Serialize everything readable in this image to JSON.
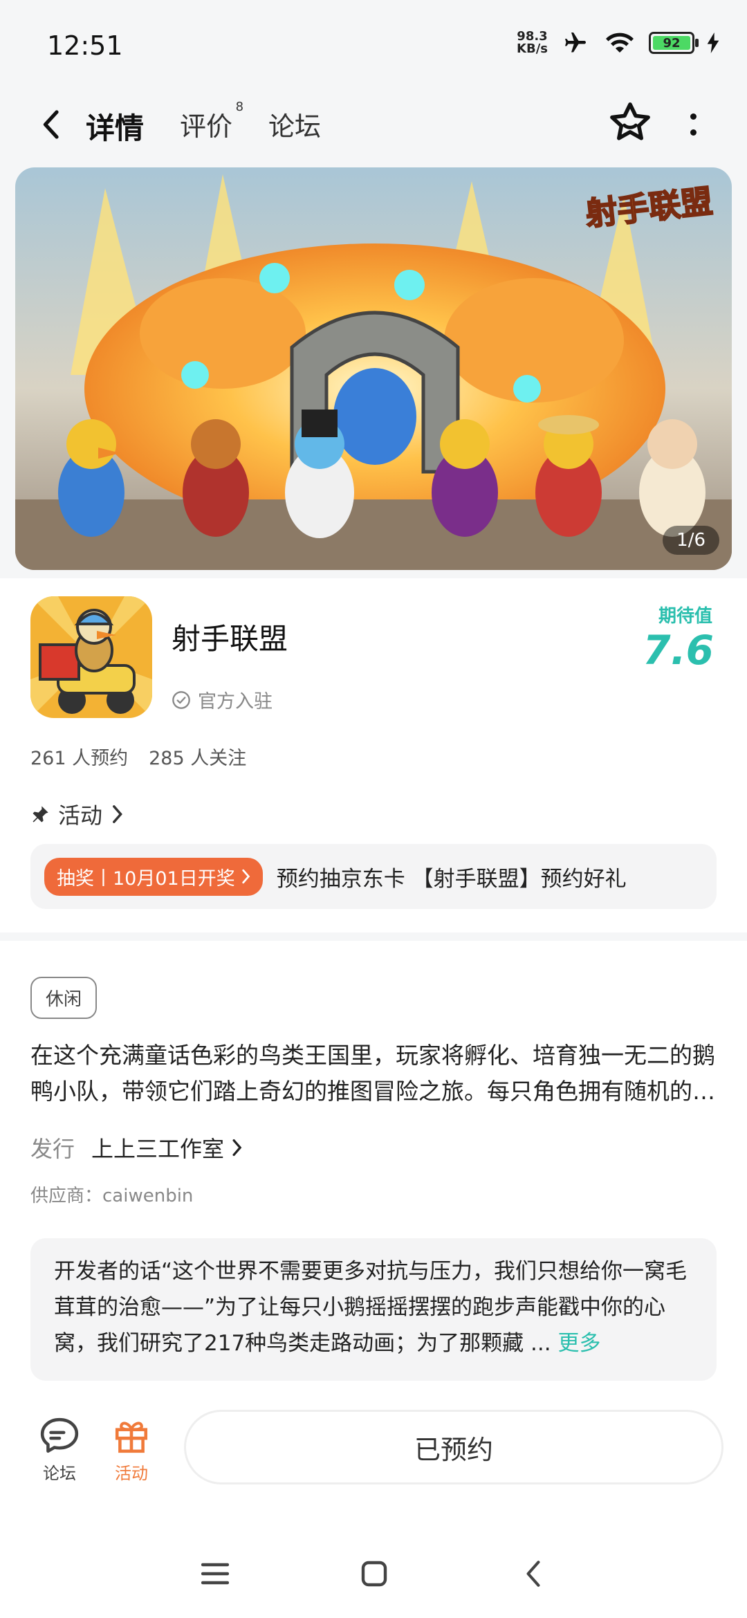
{
  "status_bar": {
    "time": "12:51",
    "net_speed_value": "98.3",
    "net_speed_unit": "KB/s",
    "battery_level": "92"
  },
  "nav": {
    "tabs": [
      {
        "label": "详情",
        "active": true
      },
      {
        "label": "评价",
        "badge": "8"
      },
      {
        "label": "论坛"
      }
    ]
  },
  "banner": {
    "logo_text": "射手联盟",
    "counter": "1/6"
  },
  "app": {
    "name": "射手联盟",
    "official_label": "官方入驻",
    "expect_label": "期待值",
    "expect_score": "7.6",
    "reservations": "261 人预约",
    "followers": "285 人关注"
  },
  "activity": {
    "section_label": "活动",
    "promo_tag": "抽奖丨10月01日开奖",
    "promo_text": "预约抽京东卡 【射手联盟】预约好礼"
  },
  "details": {
    "tag": "休闲",
    "description": "在这个充满童话色彩的鸟类王国里，玩家将孵化、培育独一无二的鹅鸭小队，带领它们踏上奇幻的推图冒险之旅。每只角色拥有随机的…",
    "publisher_label": "发行",
    "publisher_name": "上上三工作室",
    "supplier": "供应商：caiwenbin",
    "dev_note": "开发者的话“这个世界不需要更多对抗与压力，我们只想给你一窝毛茸茸的治愈——”为了让每只小鹅摇摇摆摆的跑步声能戳中你的心窝，我们研究了217种鸟类走路动画；为了那颗藏 ...",
    "dev_more": "更多"
  },
  "action_bar": {
    "forum_label": "论坛",
    "activity_label": "活动",
    "reserve_label": "已预约"
  },
  "colors": {
    "accent": "#2bbfae",
    "promo": "#ef6a3a",
    "activity_orange": "#f07a3a"
  }
}
